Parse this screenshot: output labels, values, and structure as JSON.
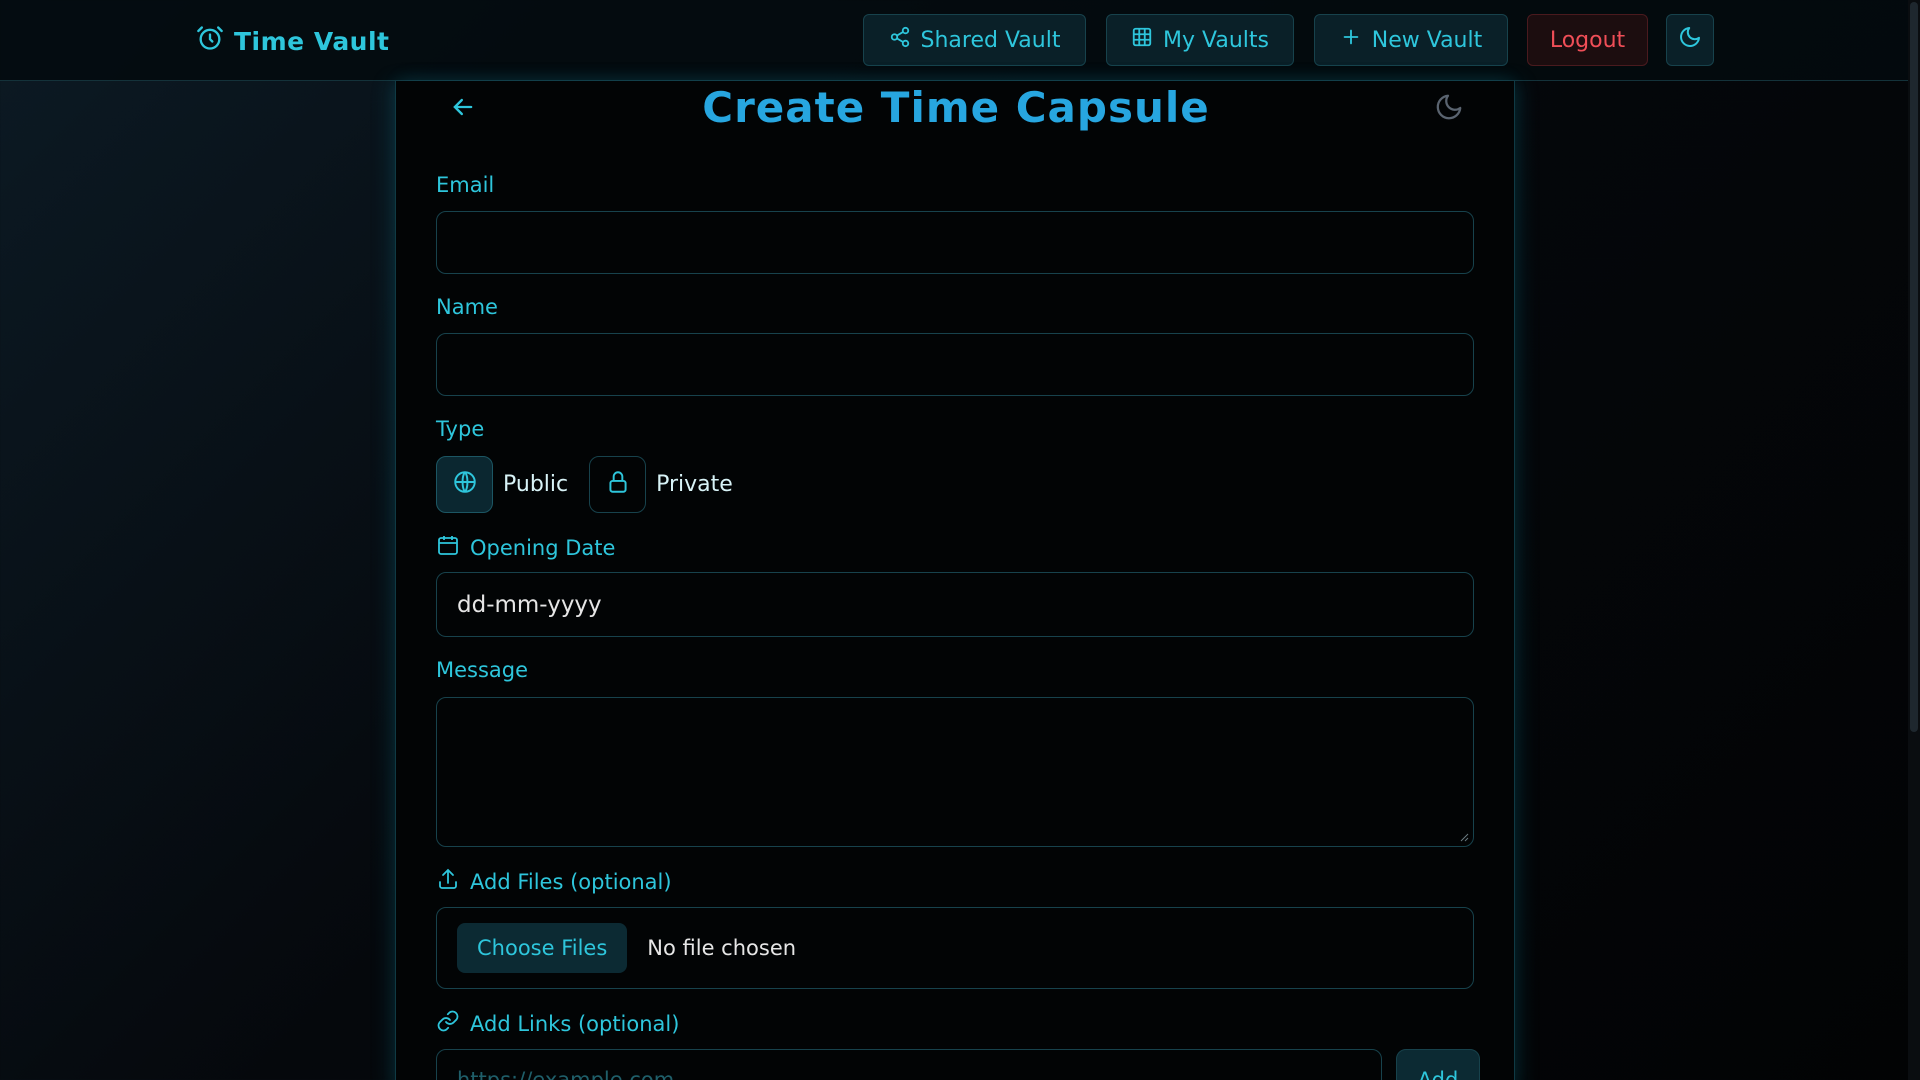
{
  "nav": {
    "brand": "Time Vault",
    "shared_vault": "Shared Vault",
    "my_vaults": "My Vaults",
    "new_vault": "New Vault",
    "logout": "Logout"
  },
  "form": {
    "title": "Create Time Capsule",
    "email_label": "Email",
    "email_value": "",
    "name_label": "Name",
    "name_value": "",
    "type_label": "Type",
    "type_options": [
      "Public",
      "Private"
    ],
    "type_selected": "Public",
    "date_label": "Opening Date",
    "date_placeholder": "dd-mm-yyyy",
    "message_label": "Message",
    "files_label": "Add Files (optional)",
    "choose_files": "Choose Files",
    "no_file": "No file chosen",
    "links_label": "Add Links (optional)",
    "link_placeholder": "https://example.com",
    "add_button": "Add"
  },
  "colors": {
    "accent": "#2ec6dc",
    "title": "#27a6e0",
    "logout": "#ef4e57",
    "background": "#020405"
  },
  "icons": {
    "brand": "alarm-clock-icon",
    "shared": "share-icon",
    "vaults": "grid-icon",
    "new": "plus-icon",
    "theme": "moon-icon",
    "back": "arrow-left-icon",
    "public": "globe-icon",
    "private": "lock-icon",
    "date": "calendar-icon",
    "files": "upload-icon",
    "links": "link-icon"
  }
}
